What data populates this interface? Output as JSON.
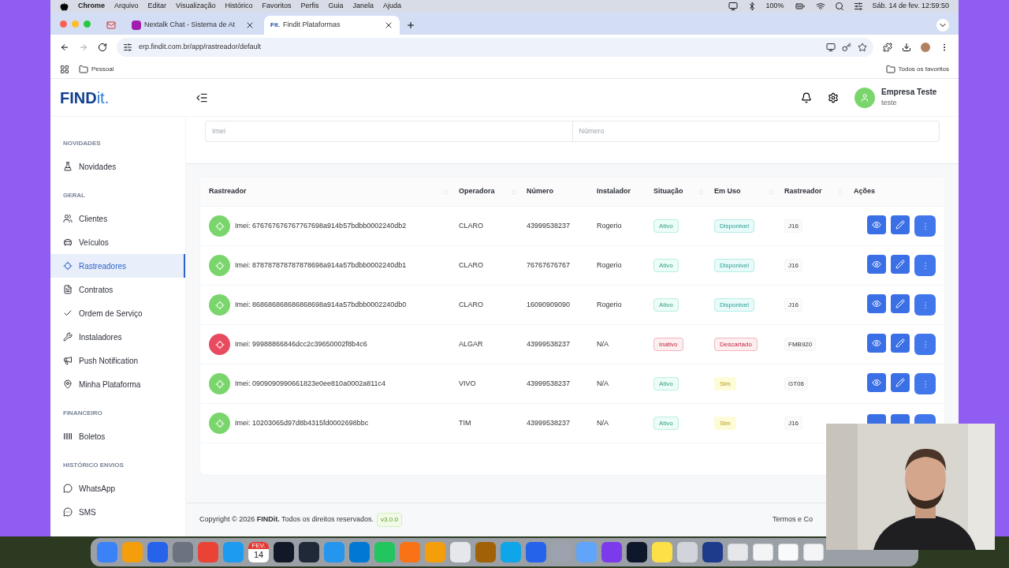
{
  "menu_bar": {
    "app": "Chrome",
    "menus": [
      "Arquivo",
      "Editar",
      "Visualização",
      "Histórico",
      "Favoritos",
      "Perfis",
      "Guia",
      "Janela",
      "Ajuda"
    ],
    "battery": "100%",
    "clock": "Sáb. 14 de fev. 12:59:50"
  },
  "browser": {
    "tabs": [
      {
        "kind": "pinned",
        "selected": false
      },
      {
        "kind": "page",
        "title": "Nextalk Chat - Sistema de At",
        "selected": false
      },
      {
        "kind": "page",
        "favicon": "Fit.",
        "title": "Findit Plataformas",
        "selected": true
      }
    ],
    "address": "erp.findit.com.br/app/rastreador/default",
    "bookmarks": [
      "Pessoal"
    ],
    "all_bookmarks": "Todos os favoritos"
  },
  "header": {
    "logo_strong": "FIND",
    "logo_light": "it.",
    "company": "Empresa Teste",
    "user": "teste"
  },
  "sidebar": [
    {
      "section": "NOVIDADES",
      "items": [
        {
          "label": "Novidades",
          "selected": false
        }
      ]
    },
    {
      "section": "GERAL",
      "items": [
        {
          "label": "Clientes",
          "selected": false
        },
        {
          "label": "Veículos",
          "selected": false
        },
        {
          "label": "Rastreadores",
          "selected": true
        },
        {
          "label": "Contratos",
          "selected": false
        },
        {
          "label": "Ordem de Serviço",
          "selected": false
        },
        {
          "label": "Instaladores",
          "selected": false
        },
        {
          "label": "Push Notification",
          "selected": false
        },
        {
          "label": "Minha Plataforma",
          "selected": false
        }
      ]
    },
    {
      "section": "FINANCEIRO",
      "items": [
        {
          "label": "Boletos",
          "selected": false
        }
      ]
    },
    {
      "section": "HISTÓRICO ENVIOS",
      "items": [
        {
          "label": "WhatsApp",
          "selected": false
        },
        {
          "label": "SMS",
          "selected": false
        }
      ]
    }
  ],
  "filters": [
    {
      "placeholder": "Imei"
    },
    {
      "placeholder": "Número"
    }
  ],
  "table": {
    "columns": [
      {
        "label": "Rastreador",
        "sortable": true
      },
      {
        "label": "Operadora",
        "sortable": true
      },
      {
        "label": "Número",
        "sortable": false
      },
      {
        "label": "Instalador",
        "sortable": false
      },
      {
        "label": "Situação",
        "sortable": true
      },
      {
        "label": "Em Uso",
        "sortable": true
      },
      {
        "label": "Rastreador",
        "sortable": true
      },
      {
        "label": "Ações",
        "sortable": false
      }
    ],
    "rows": [
      {
        "imei": "Imei: 676767676767767698a914b57bdbb0002240db2",
        "operadora": "CLARO",
        "numero": "43999538237",
        "instalador": "Rogerio",
        "situacao": {
          "text": "Ativo",
          "kind": "success"
        },
        "em_uso": {
          "text": "Disponivel",
          "kind": "info"
        },
        "model": "J16"
      },
      {
        "imei": "Imei: 878787878787878698a914a57bdbb0002240db1",
        "operadora": "CLARO",
        "numero": "76767676767",
        "instalador": "Rogerio",
        "situacao": {
          "text": "Ativo",
          "kind": "success"
        },
        "em_uso": {
          "text": "Disponivel",
          "kind": "info"
        },
        "model": "J16"
      },
      {
        "imei": "Imei: 868686868686868698a914a57bdbb0002240db0",
        "operadora": "CLARO",
        "numero": "16090909090",
        "instalador": "Rogerio",
        "situacao": {
          "text": "Ativo",
          "kind": "success"
        },
        "em_uso": {
          "text": "Disponivel",
          "kind": "info"
        },
        "model": "J16"
      },
      {
        "imei": "Imei: 99988866846dcc2c39650002f8b4c6",
        "operadora": "ALGAR",
        "numero": "43999538237",
        "instalador": "N/A",
        "situacao": {
          "text": "Inativo",
          "kind": "danger"
        },
        "em_uso": {
          "text": "Descartado",
          "kind": "danger"
        },
        "model": "FMB920"
      },
      {
        "imei": "Imei: 0909090990661823e0ee810a0002a811c4",
        "operadora": "VIVO",
        "numero": "43999538237",
        "instalador": "N/A",
        "situacao": {
          "text": "Ativo",
          "kind": "success"
        },
        "em_uso": {
          "text": "Sim",
          "kind": "warning"
        },
        "model": "GT06"
      },
      {
        "imei": "Imei: 10203065d97d8b4315fd0002698bbc",
        "operadora": "TIM",
        "numero": "43999538237",
        "instalador": "N/A",
        "situacao": {
          "text": "Ativo",
          "kind": "success"
        },
        "em_uso": {
          "text": "Sim",
          "kind": "warning"
        },
        "model": "J16"
      }
    ]
  },
  "footer": {
    "copyright": "Copyright © 2026 **FINDit.** Todos os direitos reservados.",
    "version": "v3.0.0",
    "terms": "Termos e Co"
  },
  "dock": {
    "calendar_month": "FEV.",
    "calendar_day": "14",
    "apps": [
      {
        "kind": "app",
        "color": "#3b82f6"
      },
      {
        "kind": "app",
        "color": "#f59e0b"
      },
      {
        "kind": "app",
        "color": "#2563eb"
      },
      {
        "kind": "app",
        "color": "#6b7280"
      },
      {
        "kind": "app",
        "color": "#ea4335"
      },
      {
        "kind": "app",
        "color": "#1d9bf0"
      },
      {
        "kind": "calendar",
        "color": "#ffffff"
      },
      {
        "kind": "app",
        "color": "#111827"
      },
      {
        "kind": "app",
        "color": "#1f2937"
      },
      {
        "kind": "app",
        "color": "#2496ed"
      },
      {
        "kind": "app",
        "color": "#0078d4"
      },
      {
        "kind": "app",
        "color": "#22c55e"
      },
      {
        "kind": "app",
        "color": "#f97316"
      },
      {
        "kind": "app",
        "color": "#f59e0b"
      },
      {
        "kind": "app",
        "color": "#e5e7eb"
      },
      {
        "kind": "app",
        "color": "#a16207"
      },
      {
        "kind": "app",
        "color": "#0ea5e9"
      },
      {
        "kind": "app",
        "color": "#2563eb"
      },
      {
        "kind": "app",
        "color": "#9ca3af"
      },
      {
        "kind": "app",
        "color": "#60a5fa"
      },
      {
        "kind": "app",
        "color": "#7c3aed"
      },
      {
        "kind": "app",
        "color": "#0f172a"
      },
      {
        "kind": "app",
        "color": "#fde047"
      },
      {
        "kind": "app",
        "color": "#d1d5db"
      },
      {
        "kind": "app",
        "color": "#1e3a8a"
      },
      {
        "kind": "document",
        "color": "#e5e7eb"
      },
      {
        "kind": "document",
        "color": "#f3f4f6"
      },
      {
        "kind": "document",
        "color": "#f9fafb"
      },
      {
        "kind": "document",
        "color": "#f3f4f6"
      }
    ]
  }
}
